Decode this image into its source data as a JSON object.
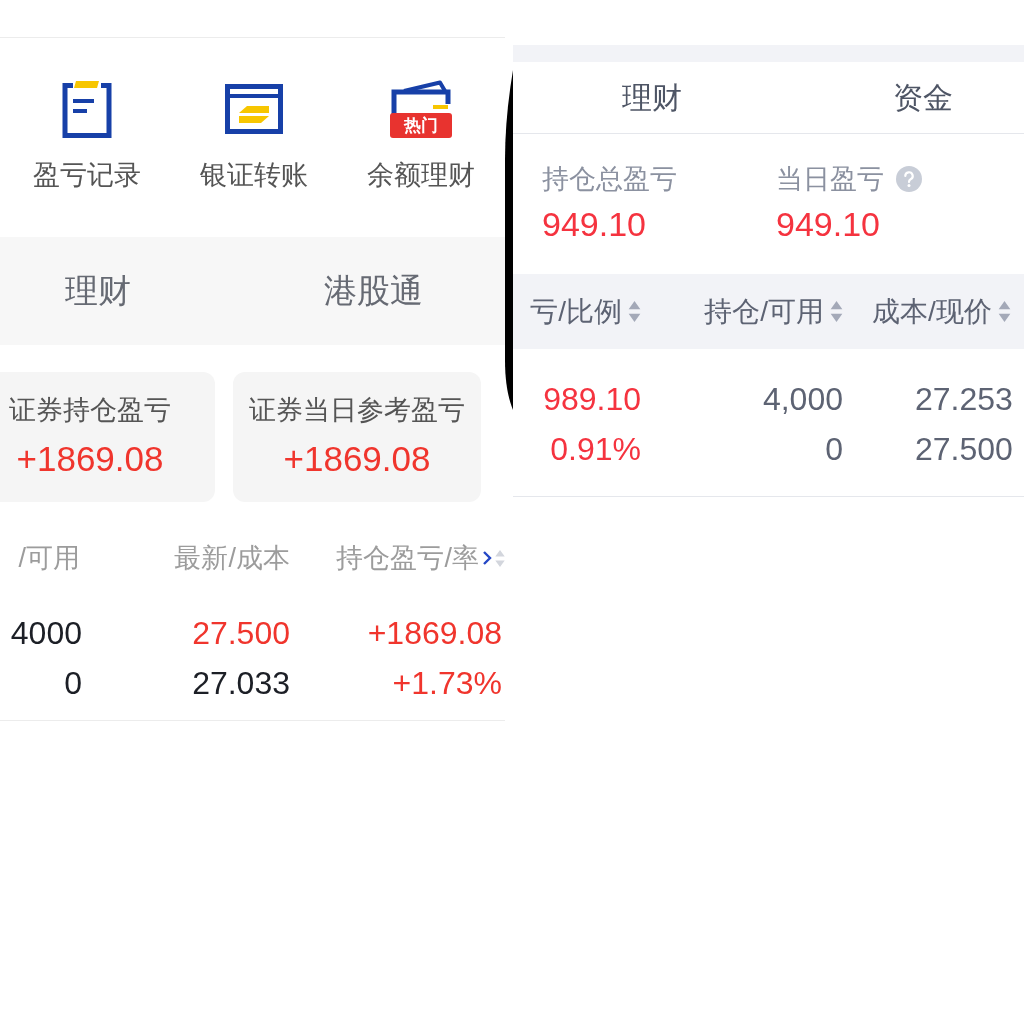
{
  "left_screen": {
    "shortcuts": [
      {
        "kind": "record",
        "label": "盈亏记录"
      },
      {
        "kind": "transfer",
        "label": "银证转账"
      },
      {
        "kind": "wallet",
        "label": "余额理财",
        "badge": "热门"
      }
    ],
    "tabs": [
      {
        "label": "理财",
        "selected": false
      },
      {
        "label": "港股通",
        "selected": false
      }
    ],
    "cards": [
      {
        "label": "证券持仓盈亏",
        "value": "+1869.08",
        "up": true
      },
      {
        "label": "证券当日参考盈亏",
        "value": "+1869.08",
        "up": true
      }
    ],
    "table": {
      "columns": [
        {
          "label": "/可用",
          "sortable": false
        },
        {
          "label": "最新/成本",
          "sortable": false
        },
        {
          "label": "持仓盈亏/率",
          "sortable": true
        }
      ],
      "rows": [
        {
          "cells": [
            [
              {
                "text": "4000",
                "up": false
              },
              {
                "text": "0",
                "up": false
              }
            ],
            [
              {
                "text": "27.500",
                "up": true
              },
              {
                "text": "27.033",
                "up": false
              }
            ],
            [
              {
                "text": "+1869.08",
                "up": true
              },
              {
                "text": "+1.73%",
                "up": true
              }
            ]
          ]
        }
      ]
    }
  },
  "right_screen": {
    "tabs": [
      {
        "label": "理财",
        "selected": false
      },
      {
        "label": "资金",
        "selected": false
      }
    ],
    "summary": [
      {
        "label": "持仓总盈亏",
        "value": "949.10",
        "up": true,
        "help": false
      },
      {
        "label": "当日盈亏",
        "value": "949.10",
        "up": true,
        "help": true
      }
    ],
    "table": {
      "columns": [
        {
          "label": "亏/比例",
          "sortable": true
        },
        {
          "label": "持仓/可用",
          "sortable": true
        },
        {
          "label": "成本/现价",
          "sortable": true
        }
      ],
      "rows": [
        {
          "cells": [
            [
              {
                "text": "989.10",
                "up": true
              },
              {
                "text": "0.91%",
                "up": true
              }
            ],
            [
              {
                "text": "4,000",
                "up": false
              },
              {
                "text": "0",
                "up": false
              }
            ],
            [
              {
                "text": "27.253",
                "up": false
              },
              {
                "text": "27.500",
                "up": false
              }
            ]
          ]
        }
      ]
    }
  }
}
